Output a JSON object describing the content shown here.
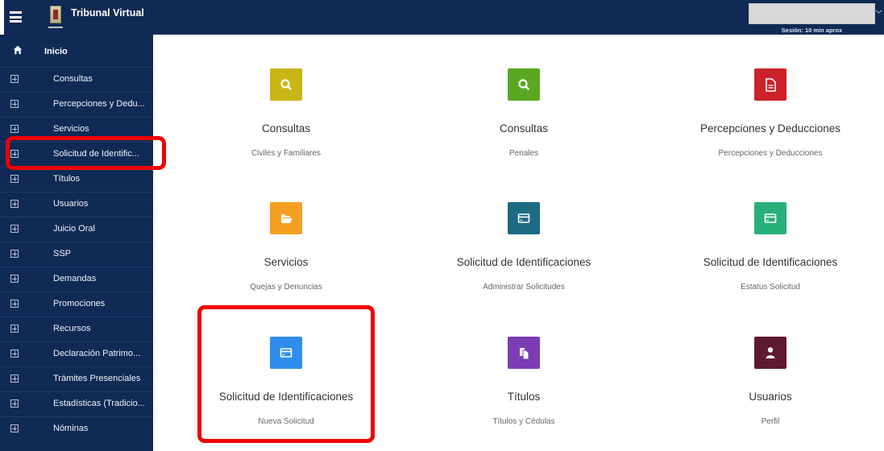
{
  "header": {
    "app_title": "Tribunal Virtual",
    "session_text": "Sesión: 10 min aprox",
    "user_select_value": ""
  },
  "sidebar": {
    "home_label": "Inicio",
    "items": [
      {
        "label": "Consultas"
      },
      {
        "label": "Percepciones y Dedu..."
      },
      {
        "label": "Servicios"
      },
      {
        "label": "Solicitud de Identific..."
      },
      {
        "label": "Títulos"
      },
      {
        "label": "Usuarios"
      },
      {
        "label": "Juicio Oral"
      },
      {
        "label": "SSP"
      },
      {
        "label": "Demandas"
      },
      {
        "label": "Promociones"
      },
      {
        "label": "Recursos"
      },
      {
        "label": "Declaración Patrimo..."
      },
      {
        "label": "Trámites Presenciales"
      },
      {
        "label": "Estadísticas (Tradicio..."
      },
      {
        "label": "Nóminas"
      }
    ]
  },
  "cards": [
    {
      "title": "Consultas",
      "subtitle": "Civiles y Familiares",
      "color": "#c9b515",
      "icon": "search-icon"
    },
    {
      "title": "Consultas",
      "subtitle": "Penales",
      "color": "#5aa822",
      "icon": "search-icon"
    },
    {
      "title": "Percepciones y Deducciones",
      "subtitle": "Percepciones y Deducciones",
      "color": "#cc2229",
      "icon": "document-icon"
    },
    {
      "title": "Servicios",
      "subtitle": "Quejas y Denuncias",
      "color": "#f5a023",
      "icon": "folder-open-icon"
    },
    {
      "title": "Solicitud de Identificaciones",
      "subtitle": "Administrar Solicitudes",
      "color": "#1d6a84",
      "icon": "id-card-icon"
    },
    {
      "title": "Solicitud de Identificaciones",
      "subtitle": "Estatus Solicitud",
      "color": "#27b07a",
      "icon": "id-card-icon"
    },
    {
      "title": "Solicitud de Identificaciones",
      "subtitle": "Nueva Solicitud",
      "color": "#2f8ded",
      "icon": "id-card-icon"
    },
    {
      "title": "Títulos",
      "subtitle": "Títulos y Cédulas",
      "color": "#7b3bb3",
      "icon": "copy-icon"
    },
    {
      "title": "Usuarios",
      "subtitle": "Perfil",
      "color": "#5e1a32",
      "icon": "user-icon"
    }
  ],
  "colors": {
    "navy": "#0e2a55",
    "highlight_red": "#ee0000"
  }
}
